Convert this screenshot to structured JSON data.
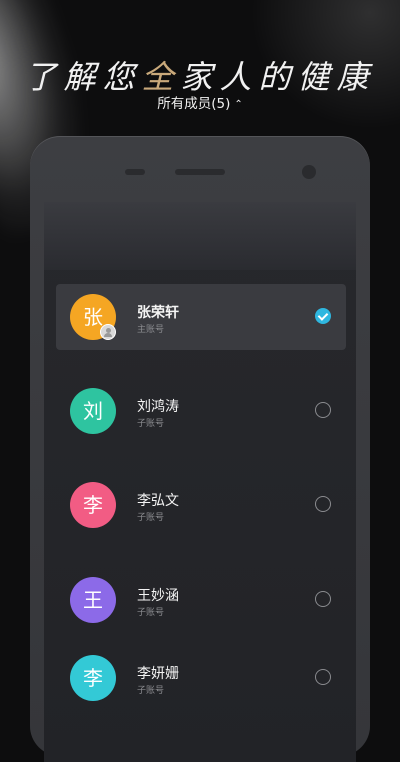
{
  "headline": {
    "part1": "了解您",
    "highlight": "全",
    "part2": "家人的健康"
  },
  "header": {
    "members_label": "所有成员(5)",
    "chevron": "⌃",
    "expanded": true
  },
  "accent_color": "#2fb7e0",
  "members": [
    {
      "avatar_char": "张",
      "name": "张荣轩",
      "role": "主账号",
      "selected": true,
      "avatar_color": "#f5a623",
      "badge_icon": "user-icon"
    },
    {
      "avatar_char": "刘",
      "name": "刘鸿涛",
      "role": "子账号",
      "selected": false,
      "avatar_color": "#2ec4a0"
    },
    {
      "avatar_char": "李",
      "name": "李弘文",
      "role": "子账号",
      "selected": false,
      "avatar_color": "#f25c84"
    },
    {
      "avatar_char": "王",
      "name": "王妙涵",
      "role": "子账号",
      "selected": false,
      "avatar_color": "#8c6ae8"
    },
    {
      "avatar_char": "李",
      "name": "李妍姗",
      "role": "子账号",
      "selected": false,
      "avatar_color": "#33c9d6"
    }
  ]
}
